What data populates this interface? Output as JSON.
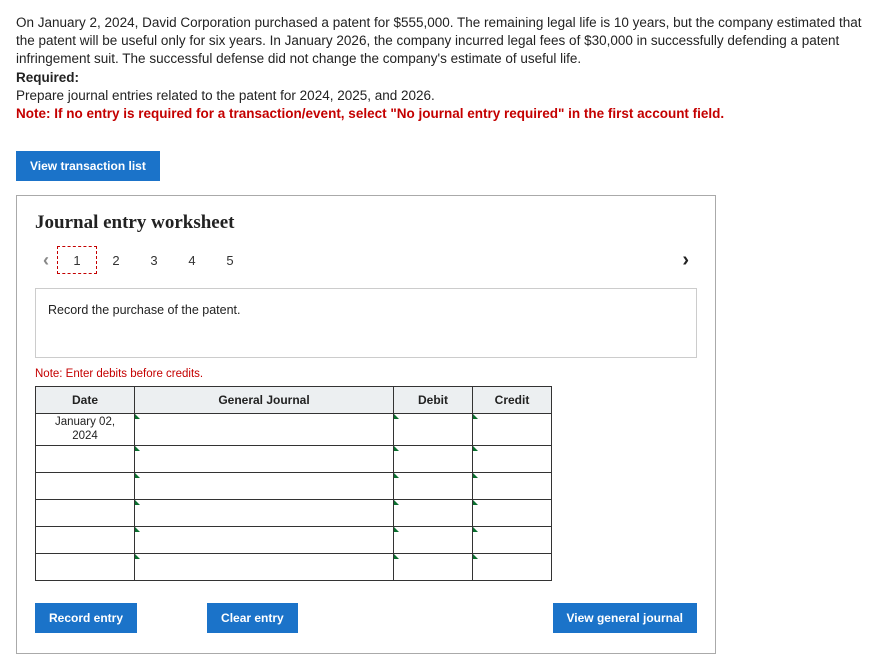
{
  "problem": {
    "p1": "On January 2, 2024, David Corporation purchased a patent for $555,000. The remaining legal life is 10 years, but the company estimated that the patent will be useful only for six years. In January 2026, the company incurred legal fees of $30,000 in successfully defending a patent infringement suit. The successful defense did not change the company's estimate of useful life.",
    "required_label": "Required:",
    "required_text": "Prepare journal entries related to the patent for 2024, 2025, and 2026.",
    "note": "Note: If no entry is required for a transaction/event, select \"No journal entry required\" in the first account field."
  },
  "buttons": {
    "view_transaction": "View transaction list",
    "record_entry": "Record entry",
    "clear_entry": "Clear entry",
    "view_general_journal": "View general journal"
  },
  "worksheet": {
    "title": "Journal entry worksheet",
    "tabs": [
      "1",
      "2",
      "3",
      "4",
      "5"
    ],
    "active_tab": "1",
    "instruction": "Record the purchase of the patent.",
    "note_small": "Note: Enter debits before credits.",
    "headers": {
      "date": "Date",
      "gj": "General Journal",
      "debit": "Debit",
      "credit": "Credit"
    },
    "first_date_line1": "January 02,",
    "first_date_line2": "2024"
  }
}
